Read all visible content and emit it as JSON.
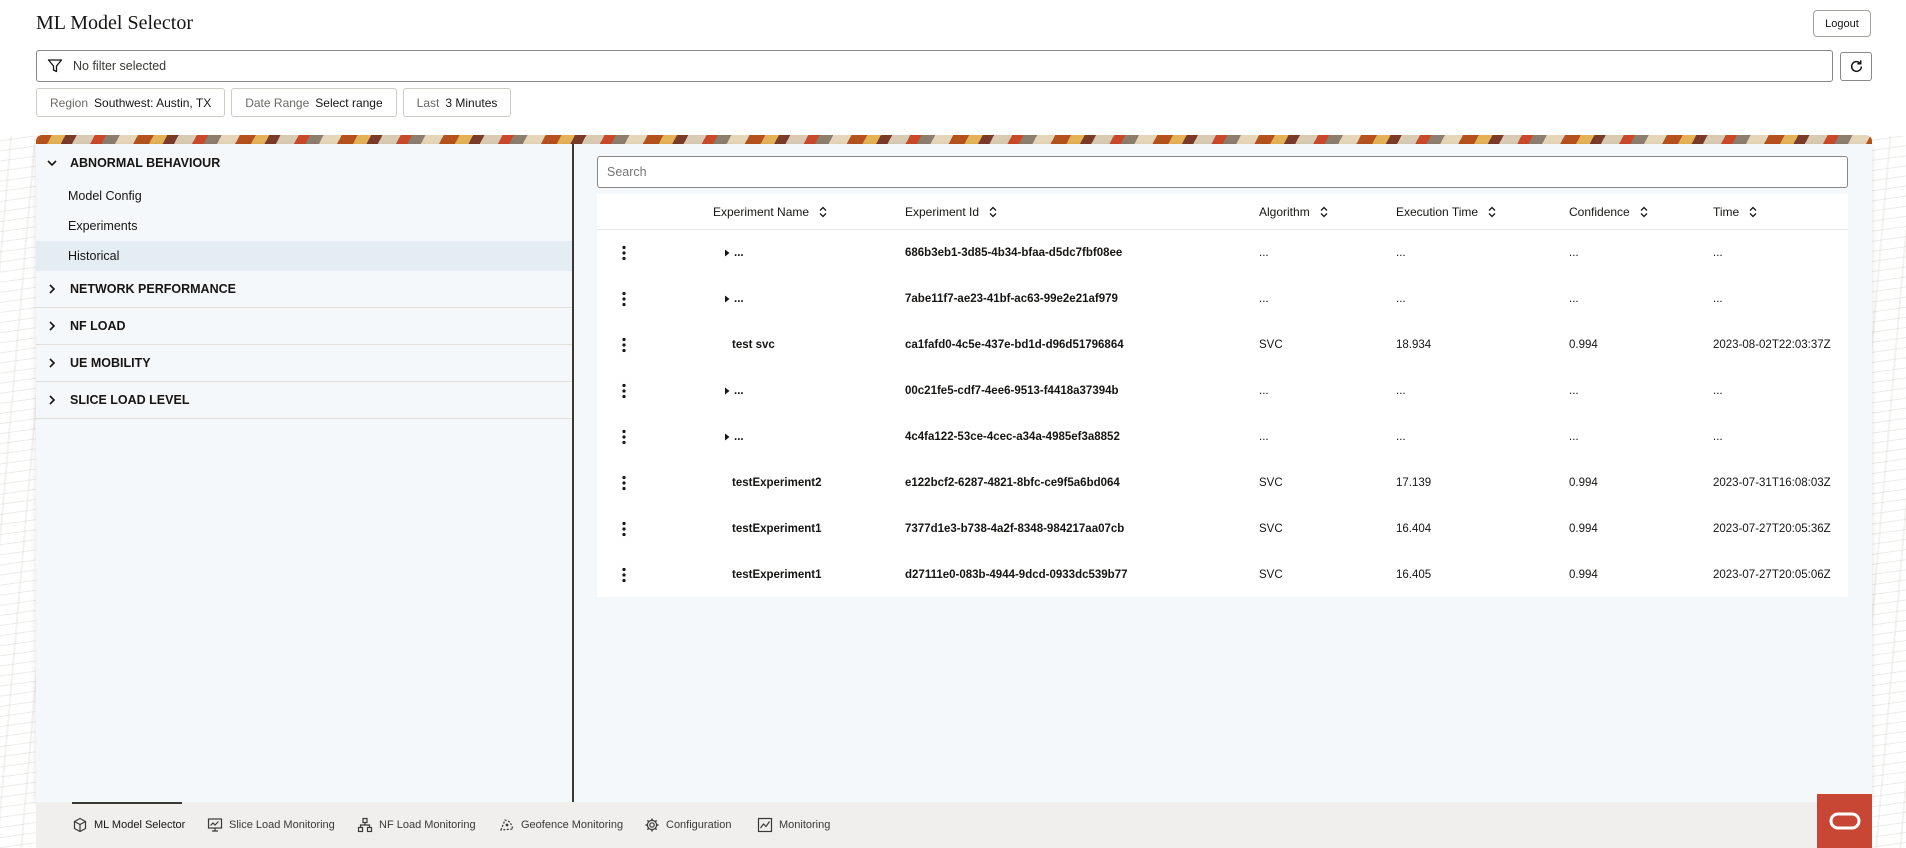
{
  "app": {
    "title": "ML Model Selector",
    "logout_label": "Logout"
  },
  "filter": {
    "text": "No filter selected"
  },
  "chips": [
    {
      "label": "Region",
      "value": "Southwest: Austin, TX"
    },
    {
      "label": "Date Range",
      "value": "Select range"
    },
    {
      "label": "Last",
      "value": "3 Minutes"
    }
  ],
  "sidebar": {
    "categories": [
      {
        "label": "ABNORMAL BEHAVIOUR",
        "expanded": true,
        "items": [
          "Model Config",
          "Experiments",
          "Historical"
        ],
        "selected": "Historical"
      },
      {
        "label": "NETWORK PERFORMANCE",
        "expanded": false
      },
      {
        "label": "NF LOAD",
        "expanded": false
      },
      {
        "label": "UE MOBILITY",
        "expanded": false
      },
      {
        "label": "SLICE LOAD LEVEL",
        "expanded": false
      }
    ]
  },
  "search": {
    "placeholder": "Search"
  },
  "table": {
    "columns": [
      "Experiment Name",
      "Experiment Id",
      "Algorithm",
      "Execution Time",
      "Confidence",
      "Time"
    ],
    "rows": [
      {
        "expandable": true,
        "name": "...",
        "id": "686b3eb1-3d85-4b34-bfaa-d5dc7fbf08ee",
        "algorithm": "...",
        "exec": "...",
        "confidence": "...",
        "time": "..."
      },
      {
        "expandable": true,
        "name": "...",
        "id": "7abe11f7-ae23-41bf-ac63-99e2e21af979",
        "algorithm": "...",
        "exec": "...",
        "confidence": "...",
        "time": "..."
      },
      {
        "expandable": false,
        "name": "test svc",
        "id": "ca1fafd0-4c5e-437e-bd1d-d96d51796864",
        "algorithm": "SVC",
        "exec": "18.934",
        "confidence": "0.994",
        "time": "2023-08-02T22:03:37Z"
      },
      {
        "expandable": true,
        "name": "...",
        "id": "00c21fe5-cdf7-4ee6-9513-f4418a37394b",
        "algorithm": "...",
        "exec": "...",
        "confidence": "...",
        "time": "..."
      },
      {
        "expandable": true,
        "name": "...",
        "id": "4c4fa122-53ce-4cec-a34a-4985ef3a8852",
        "algorithm": "...",
        "exec": "...",
        "confidence": "...",
        "time": "..."
      },
      {
        "expandable": false,
        "name": "testExperiment2",
        "id": "e122bcf2-6287-4821-8bfc-ce9f5a6bd064",
        "algorithm": "SVC",
        "exec": "17.139",
        "confidence": "0.994",
        "time": "2023-07-31T16:08:03Z"
      },
      {
        "expandable": false,
        "name": "testExperiment1",
        "id": "7377d1e3-b738-4a2f-8348-984217aa07cb",
        "algorithm": "SVC",
        "exec": "16.404",
        "confidence": "0.994",
        "time": "2023-07-27T20:05:36Z"
      },
      {
        "expandable": false,
        "name": "testExperiment1",
        "id": "d27111e0-083b-4944-9dcd-0933dc539b77",
        "algorithm": "SVC",
        "exec": "16.405",
        "confidence": "0.994",
        "time": "2023-07-27T20:05:06Z"
      }
    ]
  },
  "footer_nav": [
    {
      "label": "ML Model Selector",
      "icon": "cube-icon",
      "active": true
    },
    {
      "label": "Slice Load Monitoring",
      "icon": "monitor-icon",
      "active": false
    },
    {
      "label": "NF Load Monitoring",
      "icon": "network-icon",
      "active": false
    },
    {
      "label": "Geofence Monitoring",
      "icon": "geofence-icon",
      "active": false
    },
    {
      "label": "Configuration",
      "icon": "gear-icon",
      "active": false
    },
    {
      "label": "Monitoring",
      "icon": "chart-icon",
      "active": false
    }
  ],
  "colors": {
    "brand": "#c74634",
    "selected_row": "#e4edf2",
    "panel_bg": "#f5f8fa"
  }
}
